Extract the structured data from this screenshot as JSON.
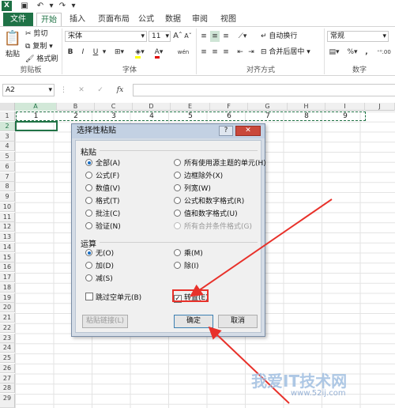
{
  "title_bar": {
    "app_logo": "X",
    "save_icon": "floppy-disk",
    "undo_icon": "undo",
    "redo_icon": "redo"
  },
  "tabs": [
    "文件",
    "开始",
    "插入",
    "页面布局",
    "公式",
    "数据",
    "审阅",
    "视图"
  ],
  "ribbon": {
    "clipboard": {
      "paste": "粘贴",
      "cut": "剪切",
      "copy": "复制",
      "format_painter": "格式刷",
      "group": "剪贴板"
    },
    "font": {
      "name": "宋体",
      "size": "11",
      "group": "字体",
      "grow": "A",
      "shrink": "A",
      "bold": "B",
      "italic": "I",
      "underline": "U",
      "font_color": "A",
      "phonetic": "wén"
    },
    "alignment": {
      "wrap": "自动换行",
      "merge": "合并后居中",
      "group": "对齐方式"
    },
    "number": {
      "format": "常规",
      "group": "数字",
      "percent": "%",
      "comma": ","
    }
  },
  "formula_bar": {
    "name_box": "A2",
    "cancel": "✕",
    "enter": "✓",
    "fx": "fx"
  },
  "columns": [
    "A",
    "B",
    "C",
    "D",
    "E",
    "F",
    "G",
    "H",
    "I",
    "J"
  ],
  "rows": [
    "1",
    "2",
    "3",
    "4",
    "5",
    "6",
    "7",
    "8",
    "9",
    "10",
    "11",
    "12",
    "13",
    "14",
    "15",
    "16",
    "17",
    "18",
    "19",
    "20",
    "21",
    "22",
    "23",
    "24",
    "25",
    "26",
    "27",
    "28",
    "29"
  ],
  "row1_values": [
    "1",
    "2",
    "3",
    "4",
    "5",
    "6",
    "7",
    "8",
    "9"
  ],
  "dialog": {
    "title": "选择性粘贴",
    "help": "?",
    "close": "✕",
    "paste_section": "粘贴",
    "paste_left": [
      "全部(A)",
      "公式(F)",
      "数值(V)",
      "格式(T)",
      "批注(C)",
      "验证(N)"
    ],
    "paste_right": [
      "所有使用源主题的单元(H)",
      "边框除外(X)",
      "列宽(W)",
      "公式和数字格式(R)",
      "值和数字格式(U)",
      "所有合并条件格式(G)"
    ],
    "operation_section": "运算",
    "op_left": [
      "无(O)",
      "加(D)",
      "减(S)"
    ],
    "op_right": [
      "乘(M)",
      "除(I)"
    ],
    "skip_blanks": "跳过空单元(B)",
    "transpose": "转置(E)",
    "transpose_checkmark": "✓",
    "paste_link": "粘贴链接(L)",
    "ok": "确定",
    "cancel": "取消"
  },
  "watermark": {
    "text": "我爱IT技术网",
    "url": "www.52ij.com"
  },
  "colors": {
    "excel_green": "#217346",
    "arrow_red": "#e8312a",
    "selected_radio": "#1a6fc4"
  }
}
